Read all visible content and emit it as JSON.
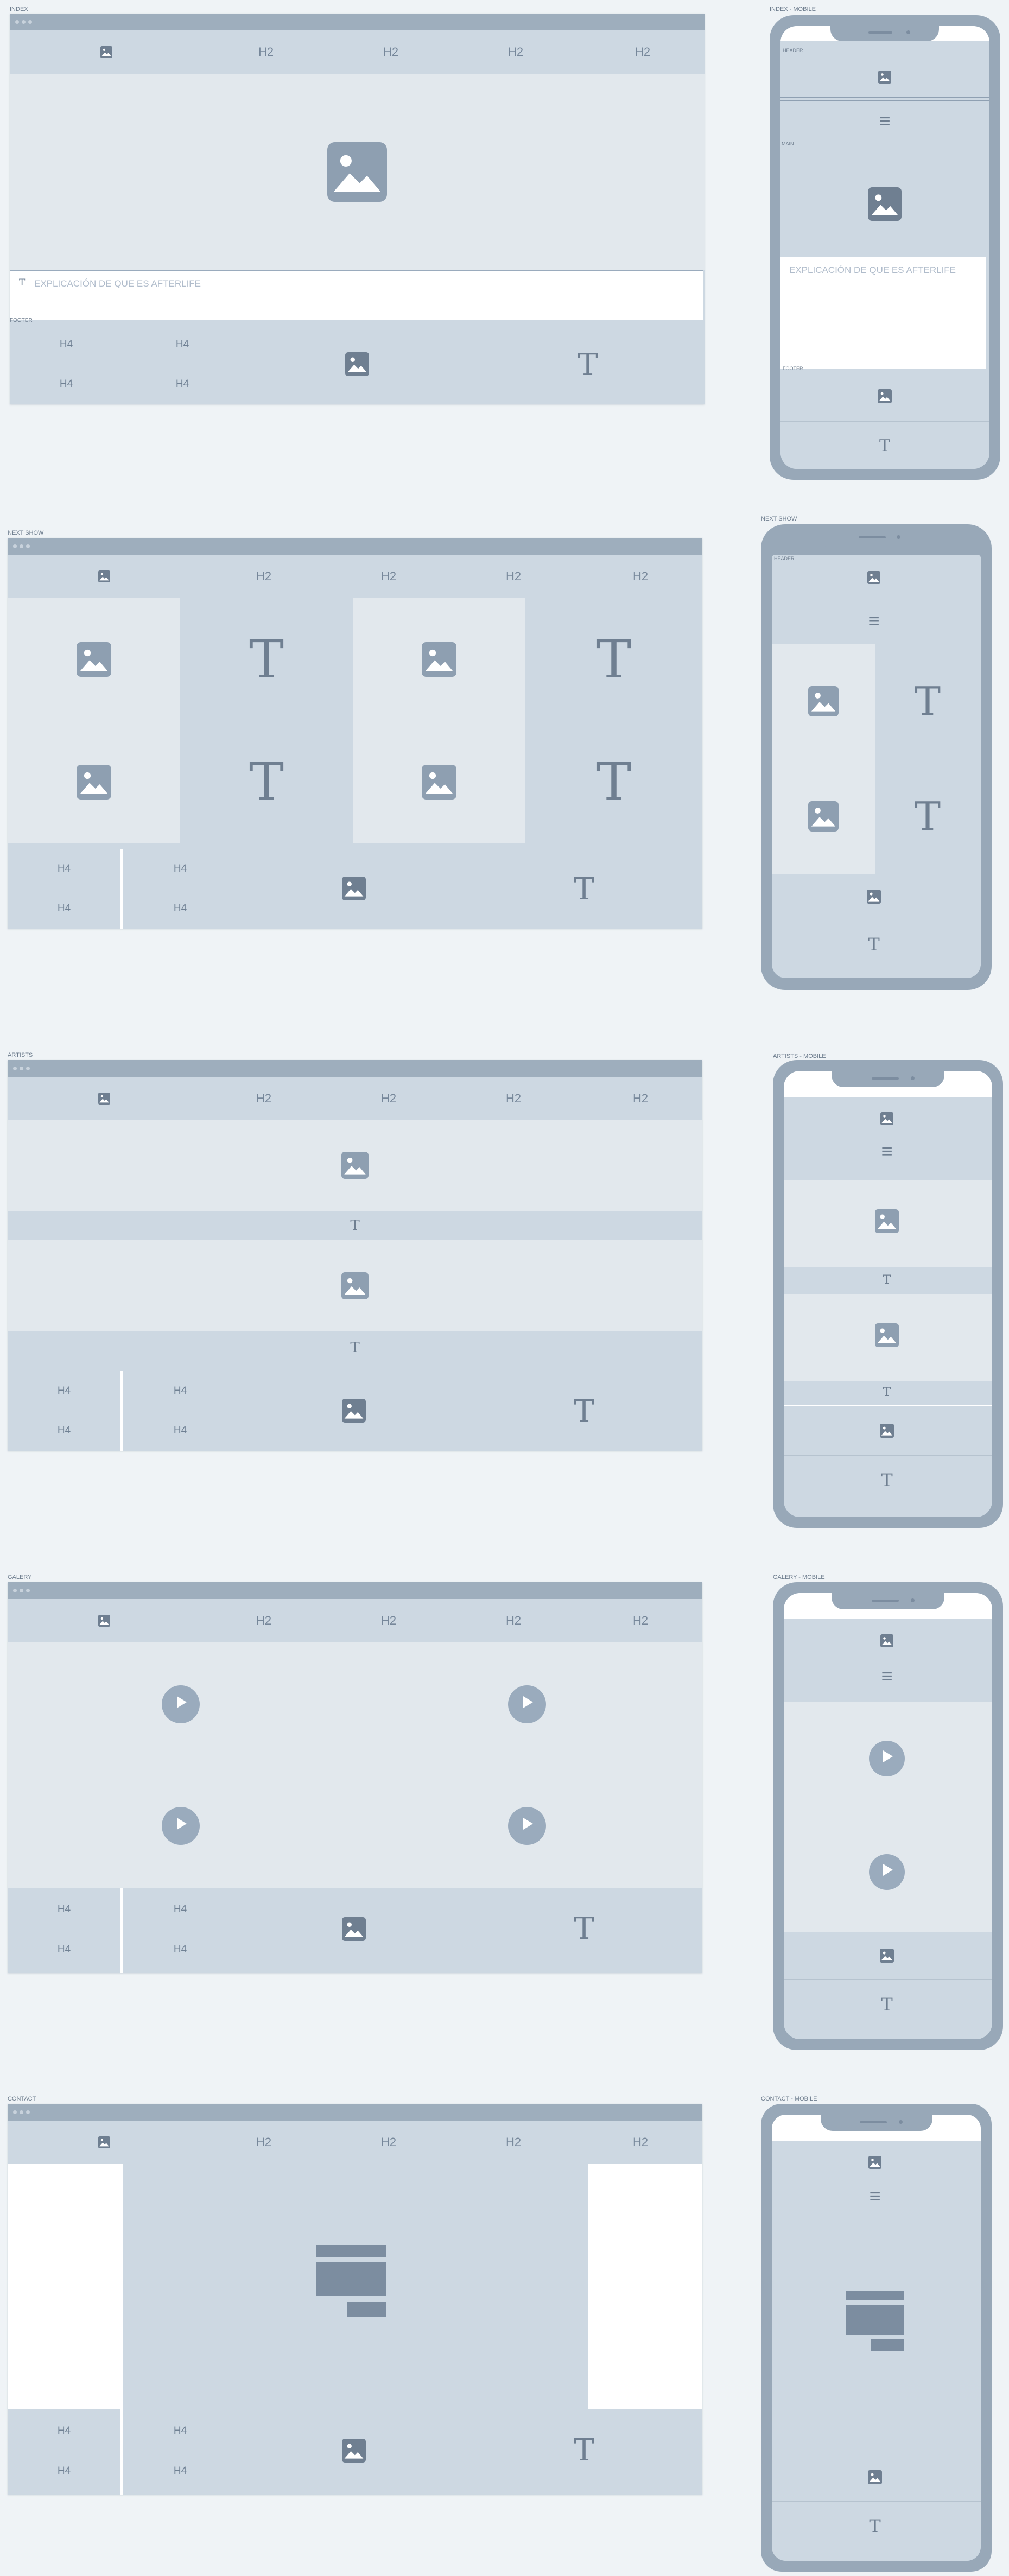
{
  "labels": {
    "index": "INDEX",
    "index_mobile": "INDEX - MOBILE",
    "next_show": "NEXT SHOW",
    "next_show_mobile": "NEXT SHOW",
    "artists": "ARTISTS",
    "artists_mobile": "ARTISTS - MOBILE",
    "galery": "GALERY",
    "galery_mobile": "GALERY - MOBILE",
    "contact": "CONTACT",
    "contact_mobile": "CONTACT - MOBILE",
    "footer": "FOOTER",
    "header": "HEADER",
    "main": "MAIN"
  },
  "nav": {
    "h2_1": "H2",
    "h2_2": "H2",
    "h2_3": "H2",
    "h2_4": "H2"
  },
  "footer": {
    "h4_a": "H4",
    "h4_b": "H4",
    "h4_c": "H4",
    "h4_d": "H4"
  },
  "index": {
    "text_placeholder": "EXPLICACIÓN DE QUE ES AFTERLIFE"
  },
  "glyphs": {
    "text_icon": "T",
    "menu_icon": "≡"
  },
  "colors": {
    "frame": "#98a8b8",
    "panel": "#cdd8e2",
    "light": "#e2e8ed",
    "icon": "#7a8a9c"
  }
}
